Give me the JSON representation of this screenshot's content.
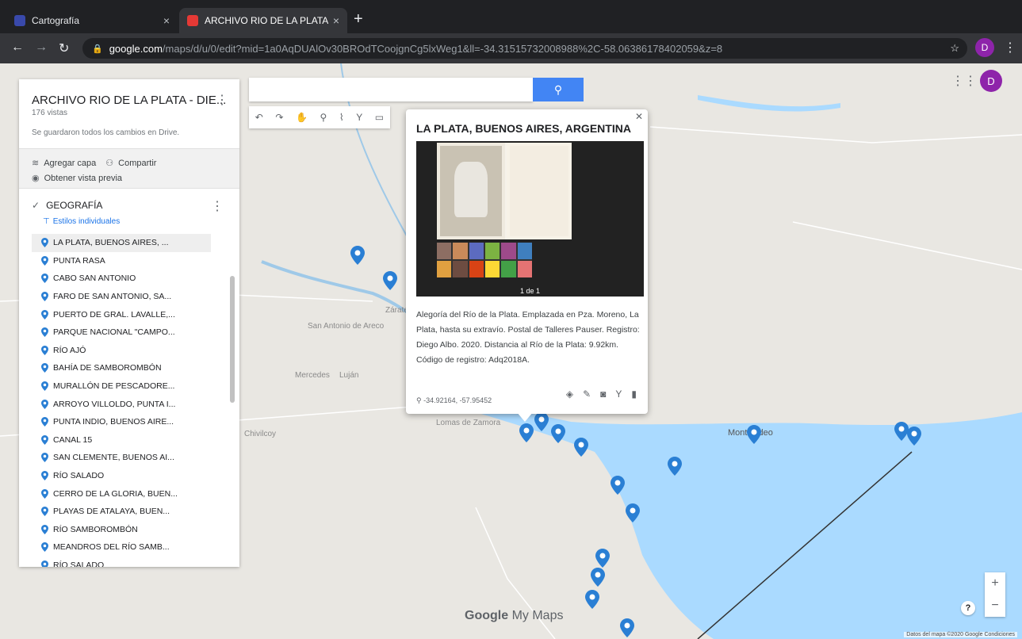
{
  "browser": {
    "tabs": [
      {
        "title": "Cartografía",
        "active": false,
        "favicon_color": "#3949ab"
      },
      {
        "title": "ARCHIVO RIO DE LA PLATA - [",
        "active": true,
        "favicon_color": "#e53935"
      }
    ],
    "url_host": "google.com",
    "url_path": "/maps/d/u/0/edit?mid=1a0AqDUAlOv30BROdTCoojgnCg5lxWeg1&ll=-34.31515732008988%2C-58.06386178402059&z=8",
    "profile_initial": "D"
  },
  "panel": {
    "title": "ARCHIVO RIO DE LA PLATA - DIE...",
    "views": "176 vistas",
    "saved": "Se guardaron todos los cambios en Drive.",
    "add_layer": "Agregar capa",
    "share": "Compartir",
    "preview": "Obtener vista previa",
    "layer_title": "GEOGRAFÍA",
    "styles": "Estilos individuales",
    "items": [
      "LA PLATA, BUENOS AIRES, ...",
      "PUNTA RASA",
      "CABO SAN ANTONIO",
      "FARO DE SAN ANTONIO, SA...",
      "PUERTO DE GRAL. LAVALLE,...",
      "PARQUE NACIONAL \"CAMPO...",
      "RÍO AJÓ",
      "BAHÍA DE SAMBOROMBÓN",
      "MURALLÓN DE PESCADORE...",
      "ARROYO VILLOLDO, PUNTA I...",
      "PUNTA INDIO, BUENOS AIRE...",
      "CANAL 15",
      "SAN CLEMENTE, BUENOS AI...",
      "RÍO SALADO",
      "CERRO DE LA GLORIA, BUEN...",
      "PLAYAS DE ATALAYA, BUEN...",
      "RÍO SAMBOROMBÓN",
      "MEANDROS DEL RÍO SAMB...",
      "RÍO SALADO"
    ]
  },
  "info": {
    "title": "LA PLATA, BUENOS AIRES, ARGENTINA",
    "counter": "1 de 1",
    "description": "Alegoría del Río de la Plata. Emplazada en Pza. Moreno, La Plata, hasta su extravío. Postal de Talleres Pauser. Registro: Diego Albo. 2020. Distancia al Río de la Plata: 9.92km. Código de registro: Adq2018A.",
    "coords": "-34.92164, -57.95452"
  },
  "map": {
    "places": [
      "Zárate",
      "Luján",
      "Mercedes",
      "Chivilcoy",
      "Lomas de Zamora",
      "Montevideo",
      "San Antonio de Areco"
    ],
    "brand_google": "Google",
    "brand_maps": "My Maps",
    "attribution": "Datos del mapa ©2020 Google   Condiciones",
    "water_color": "#aadaff",
    "pin_color": "#2a7fd4"
  }
}
